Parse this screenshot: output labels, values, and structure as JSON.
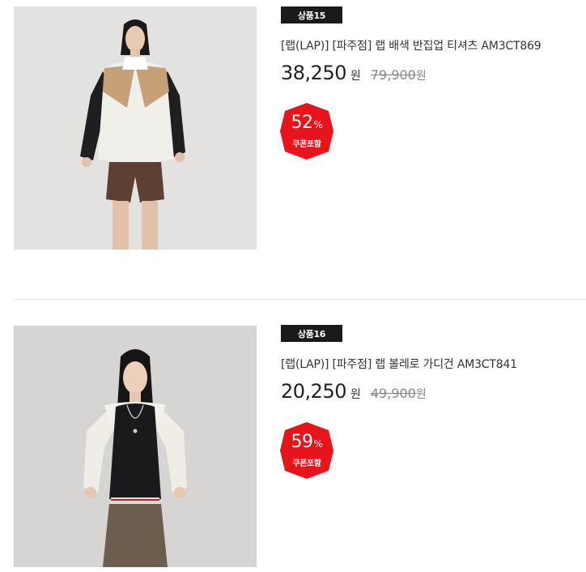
{
  "products": [
    {
      "badge": "상품15",
      "title": "[랩(LAP)] [파주점] 랩 배색 반집업 티셔츠 AM3CT869",
      "price": "38,250",
      "price_unit": "원",
      "original_price": "79,900",
      "original_unit": "원",
      "discount_rate": "52",
      "discount_symbol": "%",
      "discount_note": "쿠폰포함",
      "image": "model-in-colorblock-half-zip-windbreaker"
    },
    {
      "badge": "상품16",
      "title": "[랩(LAP)] [파주점] 랩 볼레로 가디건 AM3CT841",
      "price": "20,250",
      "price_unit": "원",
      "original_price": "49,900",
      "original_unit": "원",
      "discount_rate": "59",
      "discount_symbol": "%",
      "discount_note": "쿠폰포함",
      "image": "model-in-white-bolero-cardigan"
    }
  ],
  "colors": {
    "discount_badge": "#e8141c",
    "product_badge": "#1a1a1a",
    "divider": "#e8e8e8"
  }
}
